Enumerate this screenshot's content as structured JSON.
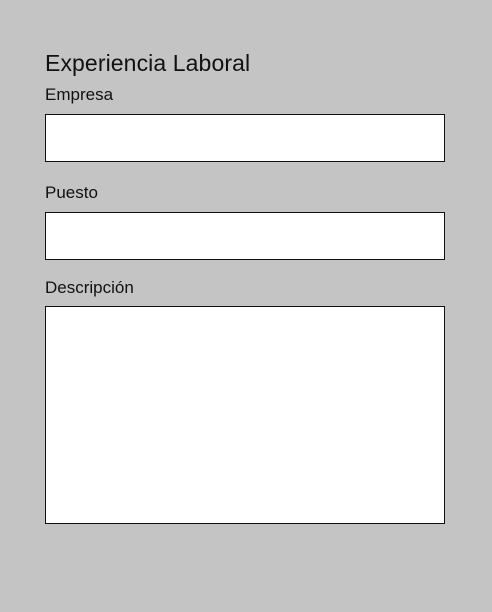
{
  "form": {
    "title": "Experiencia Laboral",
    "fields": {
      "empresa": {
        "label": "Empresa",
        "value": "",
        "placeholder": ""
      },
      "puesto": {
        "label": "Puesto",
        "value": "",
        "placeholder": ""
      },
      "descripcion": {
        "label": "Descripción",
        "value": "",
        "placeholder": ""
      }
    }
  }
}
